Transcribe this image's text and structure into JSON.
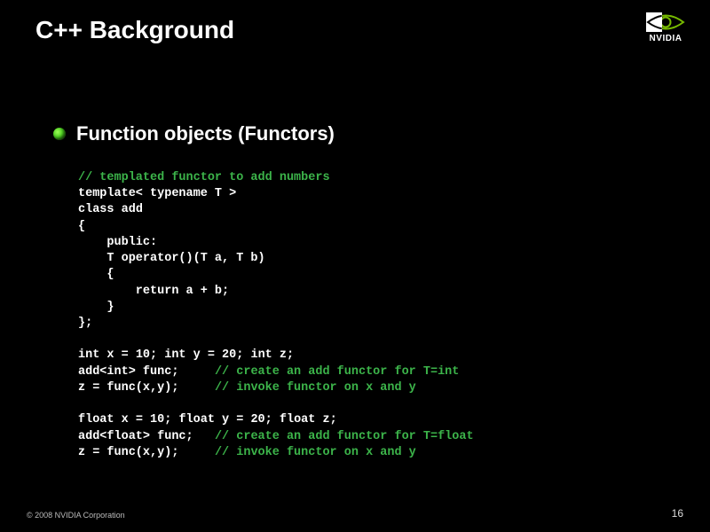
{
  "title": "C++ Background",
  "logo": {
    "name": "NVIDIA",
    "icon": "nvidia-eye-icon"
  },
  "subtitle": "Function objects (Functors)",
  "code": {
    "l1": "// templated functor to add numbers",
    "l2a": "template< typename",
    "l2b": " T >",
    "l3a": "class",
    "l3b": " add",
    "l4": "{",
    "l5": "    public:",
    "l6": "    T operator()(T a, T b)",
    "l7": "    {",
    "l8a": "        return",
    "l8b": " a + b;",
    "l9": "    }",
    "l10": "};",
    "l11a": "int",
    "l11b": " x = 10; ",
    "l11c": "int",
    "l11d": " y = 20; ",
    "l11e": "int",
    "l11f": " z;",
    "l12a": "add<",
    "l12b": "int",
    "l12c": "> func;     ",
    "l12d": "// create an add functor for T=int",
    "l13a": "z = func(x,y);     ",
    "l13b": "// invoke functor on x and y",
    "l14a": "float",
    "l14b": " x = 10; ",
    "l14c": "float",
    "l14d": " y = 20; ",
    "l14e": "float",
    "l14f": " z;",
    "l15a": "add<",
    "l15b": "float",
    "l15c": "> func;   ",
    "l15d": "// create an add functor for T=float",
    "l16a": "z = func(x,y);     ",
    "l16b": "// invoke functor on x and y"
  },
  "footer": {
    "copyright": "© 2008 NVIDIA Corporation",
    "pagenum": "16"
  }
}
